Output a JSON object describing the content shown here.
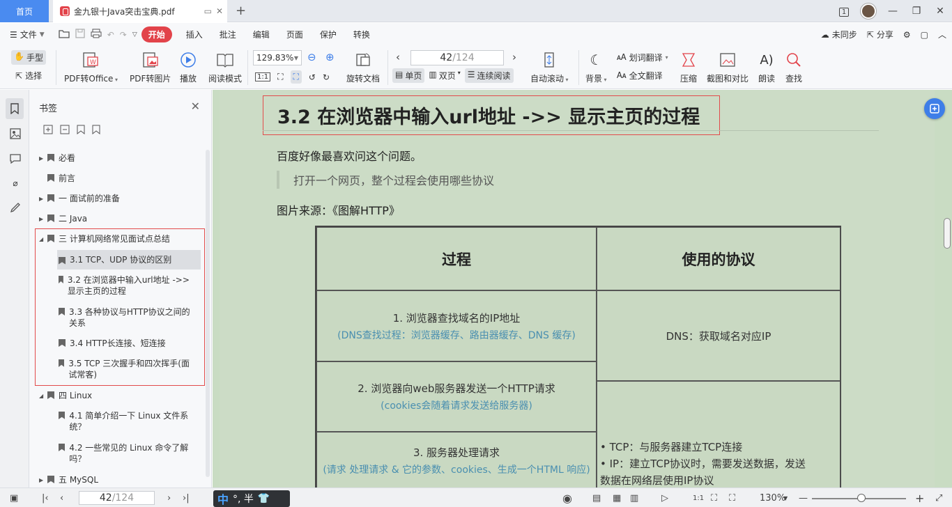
{
  "titlebar": {
    "home_tab": "首页",
    "doc_tab": "金九银十Java突击宝典.pdf",
    "new_tab": "+",
    "page_indicator": "1"
  },
  "menubar": {
    "file_label": "文件",
    "tabs": [
      "开始",
      "插入",
      "批注",
      "编辑",
      "页面",
      "保护",
      "转换"
    ],
    "active_tab": "开始",
    "sync_label": "未同步",
    "share_label": "分享"
  },
  "toolbar": {
    "hand_label": "手型",
    "select_label": "选择",
    "pdf_to_office": "PDF转Office",
    "pdf_to_image": "PDF转图片",
    "play": "播放",
    "read_mode": "阅读模式",
    "zoom_value": "129.83%",
    "rotate_doc": "旋转文档",
    "page_current": "42",
    "page_total": "/124",
    "single_page": "单页",
    "double_page": "双页",
    "continuous": "连续阅读",
    "auto_scroll": "自动滚动",
    "background": "背景",
    "word_translate": "划词翻译",
    "full_translate": "全文翻译",
    "compress": "压缩",
    "screenshot_compare": "截图和对比",
    "read_aloud": "朗读",
    "find": "查找"
  },
  "bookmarks": {
    "title": "书签",
    "items": [
      {
        "label": "必看",
        "expander": "▶"
      },
      {
        "label": "前言",
        "expander": ""
      },
      {
        "label": "一 面试前的准备",
        "expander": "▶"
      },
      {
        "label": "二 Java",
        "expander": "▶"
      },
      {
        "label": "三  计算机网络常见面试点总结",
        "expander": "◢"
      },
      {
        "label": "3.1 TCP、UDP 协议的区别",
        "expander": ""
      },
      {
        "label": "3.2    在浏览器中输入url地址 ->> 显示主页的过程",
        "expander": ""
      },
      {
        "label": "3.3 各种协议与HTTP协议之间的关系",
        "expander": ""
      },
      {
        "label": "3.4 HTTP长连接、短连接",
        "expander": ""
      },
      {
        "label": "3.5   TCP 三次握手和四次挥手(面试常客)",
        "expander": ""
      },
      {
        "label": "四 Linux",
        "expander": "◢"
      },
      {
        "label": "4.1 简单介绍一下 Linux 文件系统？",
        "expander": ""
      },
      {
        "label": "4.2 一些常见的 Linux 命令了解吗？",
        "expander": ""
      },
      {
        "label": "五 MySQL",
        "expander": "▶"
      }
    ]
  },
  "document": {
    "heading": "3.2 在浏览器中输入url地址 ->> 显示主页的过程",
    "paragraph1": "百度好像最喜欢问这个问题。",
    "quote": "打开一个网页，整个过程会使用哪些协议",
    "paragraph2": "图片来源：《图解HTTP》",
    "table": {
      "header_process": "过程",
      "header_protocol": "使用的协议",
      "step1_main": "1. 浏览器查找域名的IP地址",
      "step1_sub": "(DNS查找过程：浏览器缓存、路由器缓存、DNS 缓存)",
      "step2_main": "2. 浏览器向web服务器发送一个HTTP请求",
      "step2_sub": "(cookies会随着请求发送给服务器)",
      "step3_main": "3. 服务器处理请求",
      "step3_sub": "(请求 处理请求 & 它的参数、cookies、生成一个HTML 响应)",
      "dns": "DNS：获取域名对应IP",
      "tcp1": "• TCP：与服务器建立TCP连接",
      "ip1": "• IP：建立TCP协议时，需要发送数据，发送",
      "ip2": "数据在网络层使用IP协议"
    }
  },
  "statusbar": {
    "page_current": "42",
    "page_total": "/124",
    "ime_mode": "中",
    "ime_punct": "°, 半",
    "zoom": "130%"
  }
}
